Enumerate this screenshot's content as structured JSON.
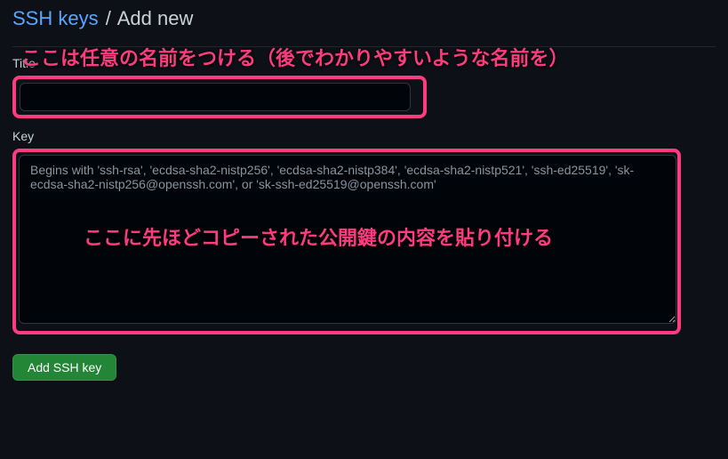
{
  "breadcrumb": {
    "link_label": "SSH keys",
    "separator": "/",
    "current": "Add new"
  },
  "annotations": {
    "title_hint": "ここは任意の名前をつける（後でわかりやすいような名前を）",
    "key_hint": "ここに先ほどコピーされた公開鍵の内容を貼り付ける"
  },
  "form": {
    "title_label": "Title",
    "title_value": "",
    "key_label": "Key",
    "key_value": "",
    "key_placeholder": "Begins with 'ssh-rsa', 'ecdsa-sha2-nistp256', 'ecdsa-sha2-nistp384', 'ecdsa-sha2-nistp521', 'ssh-ed25519', 'sk-ecdsa-sha2-nistp256@openssh.com', or 'sk-ssh-ed25519@openssh.com'",
    "submit_label": "Add SSH key"
  },
  "colors": {
    "accent_link": "#58a6ff",
    "annotation": "#ff3b7f",
    "primary_button": "#238636"
  }
}
